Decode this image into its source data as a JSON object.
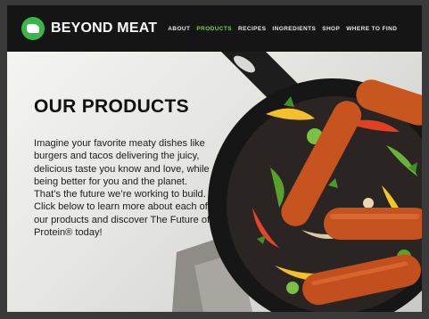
{
  "brand": {
    "name": "BEYOND MEAT",
    "accent": "#39b54a",
    "logo_icon": "steer-logo-icon"
  },
  "nav": {
    "items": [
      {
        "label": "ABOUT",
        "active": false
      },
      {
        "label": "PRODUCTS",
        "active": true
      },
      {
        "label": "RECIPES",
        "active": false
      },
      {
        "label": "INGREDIENTS",
        "active": false
      },
      {
        "label": "SHOP",
        "active": false
      },
      {
        "label": "WHERE TO FIND",
        "active": false
      }
    ]
  },
  "hero": {
    "title": "OUR PRODUCTS",
    "body": "Imagine your favorite meaty dishes like burgers and tacos delivering the juicy, delicious taste you know and love, while being better for you and the planet. That’s the future we’re working to build. Click below to learn more about each of our products and discover The Future of Protein® today!",
    "image_alt": "Skillet of sausages with peppers and onions"
  }
}
